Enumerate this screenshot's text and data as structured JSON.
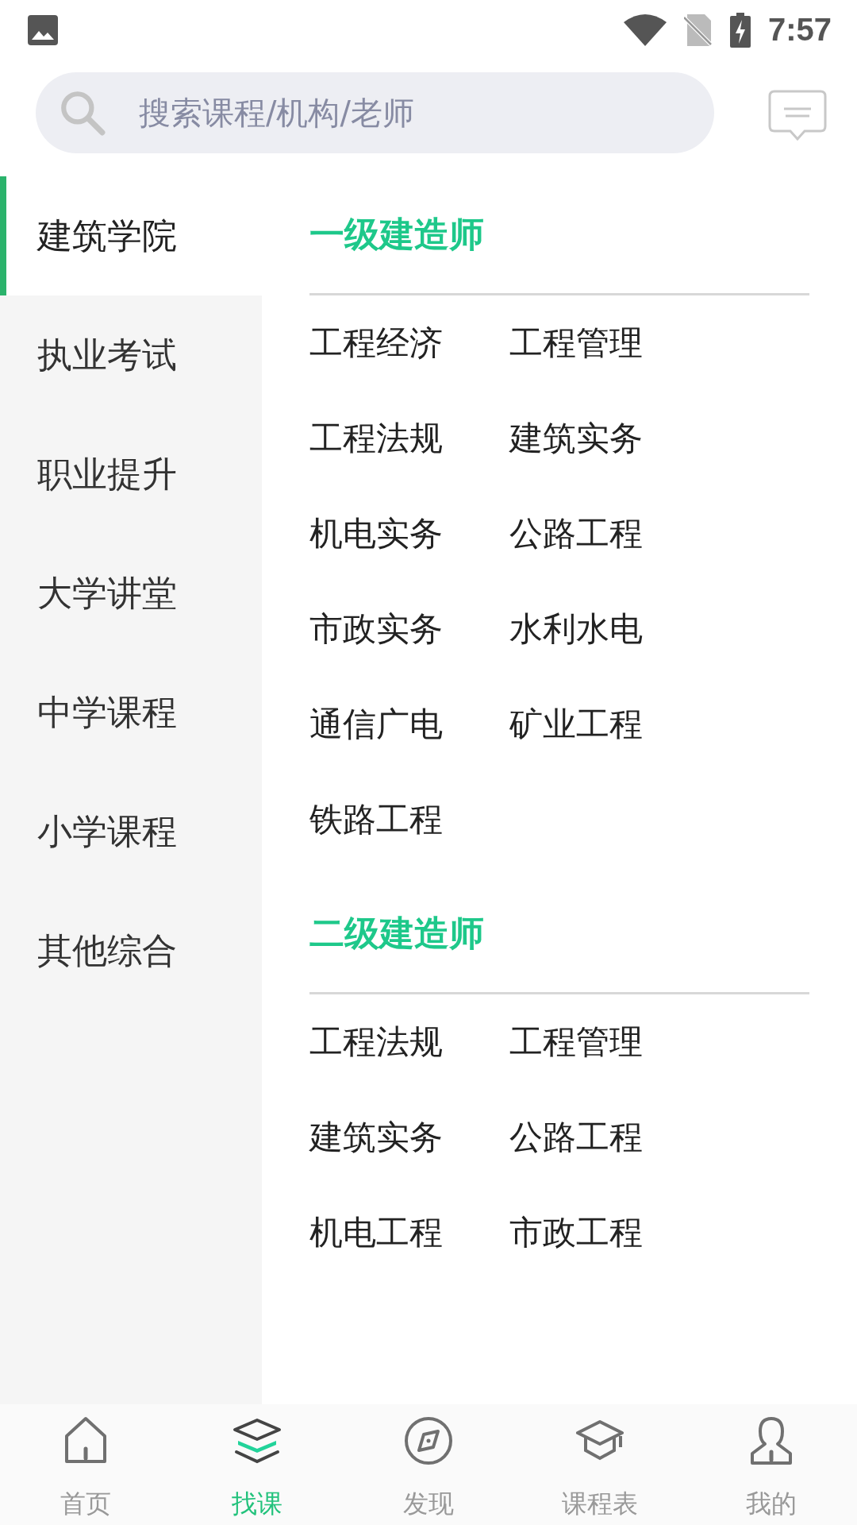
{
  "status_bar": {
    "time": "7:57"
  },
  "search": {
    "placeholder": "搜索课程/机构/老师"
  },
  "sidebar": {
    "items": [
      {
        "label": "建筑学院",
        "selected": true
      },
      {
        "label": "执业考试",
        "selected": false
      },
      {
        "label": "职业提升",
        "selected": false
      },
      {
        "label": "大学讲堂",
        "selected": false
      },
      {
        "label": "中学课程",
        "selected": false
      },
      {
        "label": "小学课程",
        "selected": false
      },
      {
        "label": "其他综合",
        "selected": false
      }
    ]
  },
  "sections": [
    {
      "title": "一级建造师",
      "items": [
        "工程经济",
        "工程管理",
        "工程法规",
        "建筑实务",
        "机电实务",
        "公路工程",
        "市政实务",
        "水利水电",
        "通信广电",
        "矿业工程",
        "铁路工程"
      ]
    },
    {
      "title": "二级建造师",
      "items": [
        "工程法规",
        "工程管理",
        "建筑实务",
        "公路工程",
        "机电工程",
        "市政工程"
      ]
    }
  ],
  "bottom_nav": [
    {
      "kind": "home",
      "label": "首页",
      "selected": false
    },
    {
      "kind": "layers",
      "label": "找课",
      "selected": true
    },
    {
      "kind": "compass",
      "label": "发现",
      "selected": false
    },
    {
      "kind": "cap",
      "label": "课程表",
      "selected": false
    },
    {
      "kind": "person",
      "label": "我的",
      "selected": false
    }
  ]
}
